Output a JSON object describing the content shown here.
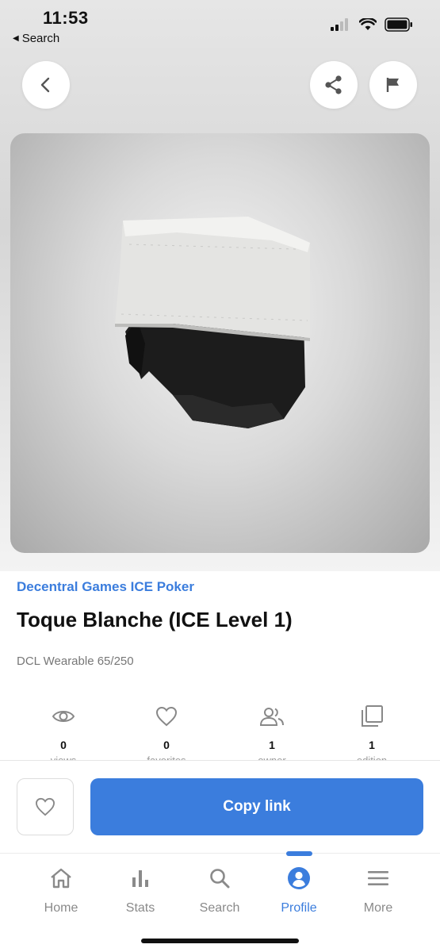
{
  "status_bar": {
    "time": "11:53",
    "back_app_label": "Search",
    "signal_icon": "cellular-signal-icon",
    "wifi_icon": "wifi-icon",
    "battery_icon": "battery-icon"
  },
  "header": {
    "back_icon": "chevron-left-icon",
    "share_icon": "share-icon",
    "flag_icon": "flag-icon"
  },
  "item": {
    "collection": "Decentral Games ICE Poker",
    "title": "Toque Blanche (ICE Level 1)",
    "subtitle": "DCL Wearable 65/250"
  },
  "stats": [
    {
      "icon": "eye-icon",
      "value": "0",
      "label": "views"
    },
    {
      "icon": "heart-icon",
      "value": "0",
      "label": "favorites"
    },
    {
      "icon": "users-icon",
      "value": "1",
      "label": "owner"
    },
    {
      "icon": "copy-icon",
      "value": "1",
      "label": "edition"
    }
  ],
  "actions": {
    "favorite_icon": "heart-outline-icon",
    "copy_link_label": "Copy link"
  },
  "tabs": [
    {
      "label": "Home",
      "icon": "home-icon",
      "active": false
    },
    {
      "label": "Stats",
      "icon": "bar-chart-icon",
      "active": false
    },
    {
      "label": "Search",
      "icon": "search-icon",
      "active": false
    },
    {
      "label": "Profile",
      "icon": "profile-icon",
      "active": true
    },
    {
      "label": "More",
      "icon": "menu-icon",
      "active": false
    }
  ],
  "colors": {
    "accent": "#3b7ddd",
    "inactive": "#8a8a8a"
  }
}
